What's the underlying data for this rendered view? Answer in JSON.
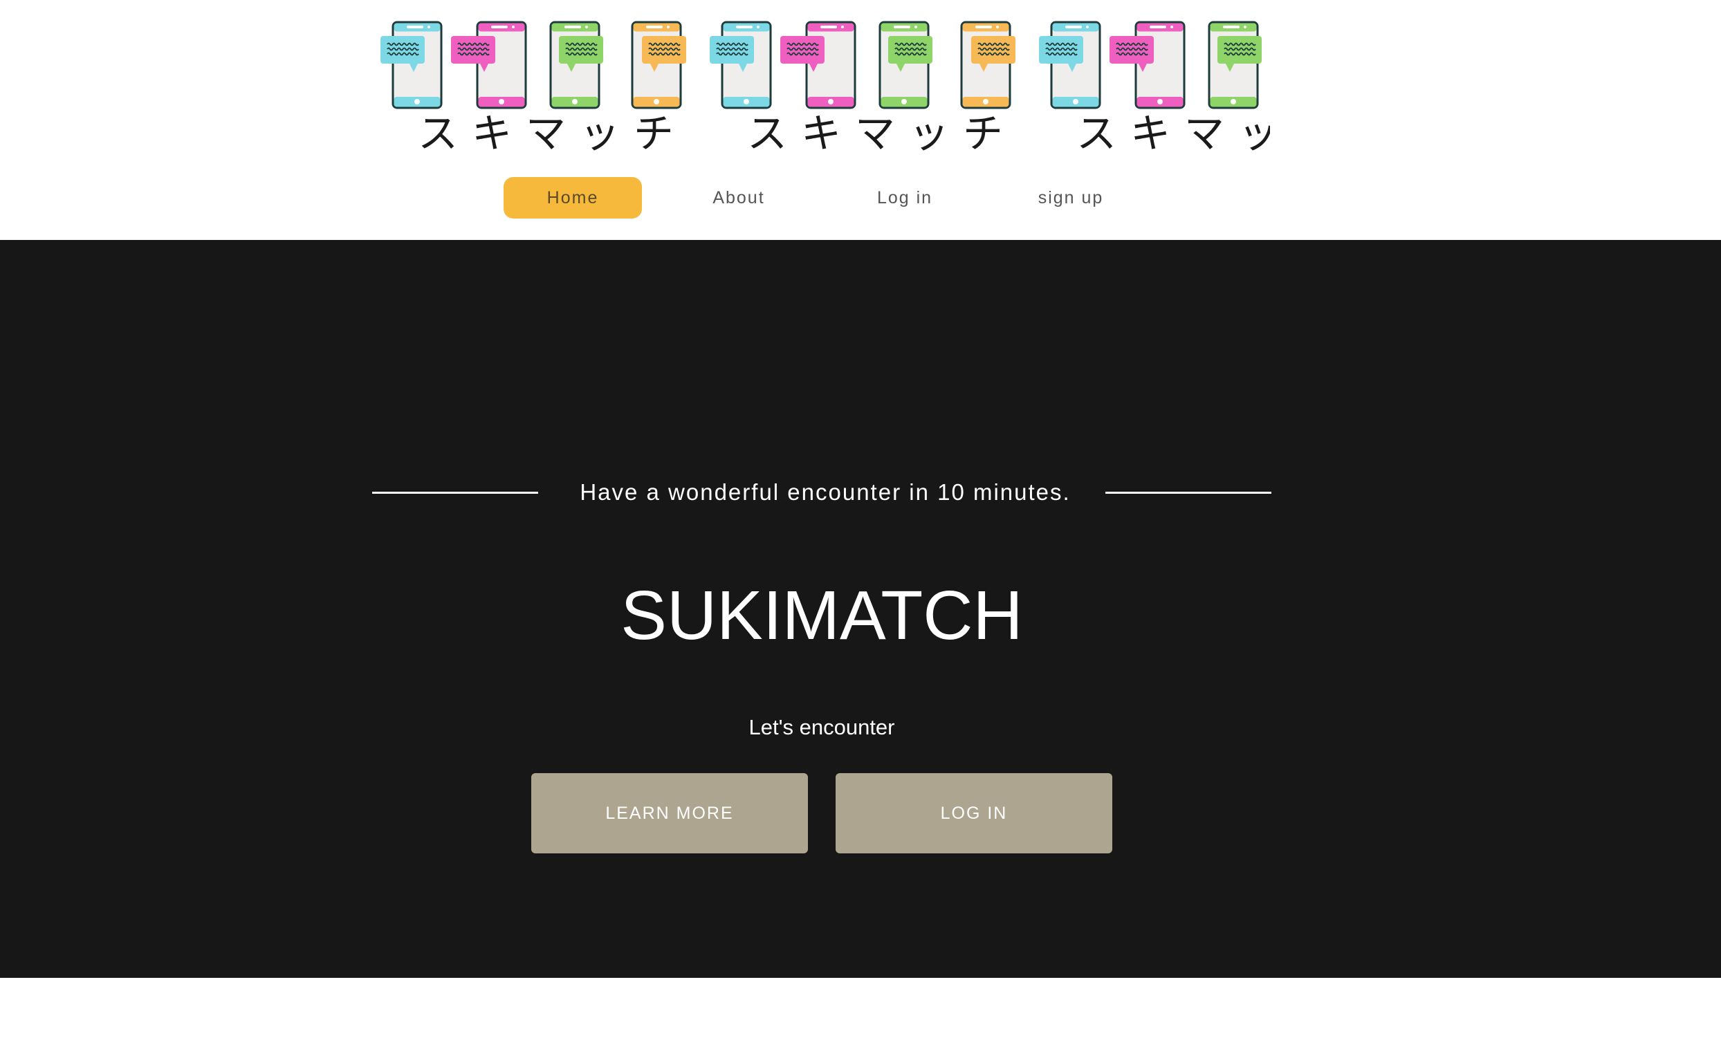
{
  "brand_logo": {
    "text": "スキマッチ",
    "repeat_count": 3,
    "phone_colors": [
      "#7dd8e6",
      "#ee5fbf",
      "#8fd468",
      "#f7b955"
    ]
  },
  "nav": {
    "items": [
      {
        "label": "Home",
        "active": true
      },
      {
        "label": "About",
        "active": false
      },
      {
        "label": "Log in",
        "active": false
      },
      {
        "label": "sign up",
        "active": false
      }
    ],
    "active_color": "#f6b93b"
  },
  "hero": {
    "tagline": "Have a wonderful encounter in 10 minutes.",
    "title": "SUKIMATCH",
    "subtitle": "Let's encounter",
    "buttons": {
      "learn_more": "LEARN MORE",
      "log_in": "LOG IN"
    },
    "background": "#171717",
    "button_color": "#ada58f"
  }
}
